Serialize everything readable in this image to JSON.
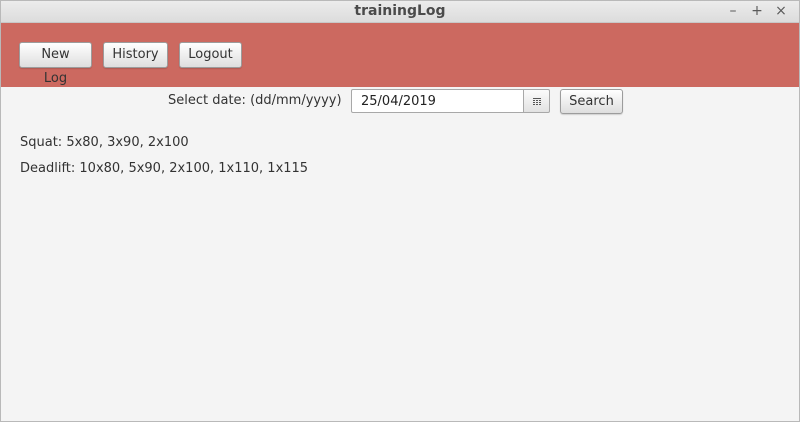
{
  "window": {
    "title": "trainingLog",
    "controls": {
      "minimize": "–",
      "maximize": "+",
      "close": "×"
    }
  },
  "toolbar": {
    "new_log_label": "New Log",
    "history_label": "History",
    "logout_label": "Logout",
    "background_color": "#cc6960"
  },
  "search": {
    "date_label": "Select date: (dd/mm/yyyy)",
    "date_value": "25/04/2019",
    "calendar_icon": "calendar-icon",
    "search_label": "Search"
  },
  "log": {
    "entries": [
      "Squat: 5x80, 3x90, 2x100",
      "Deadlift: 10x80, 5x90, 2x100, 1x110, 1x115"
    ]
  }
}
